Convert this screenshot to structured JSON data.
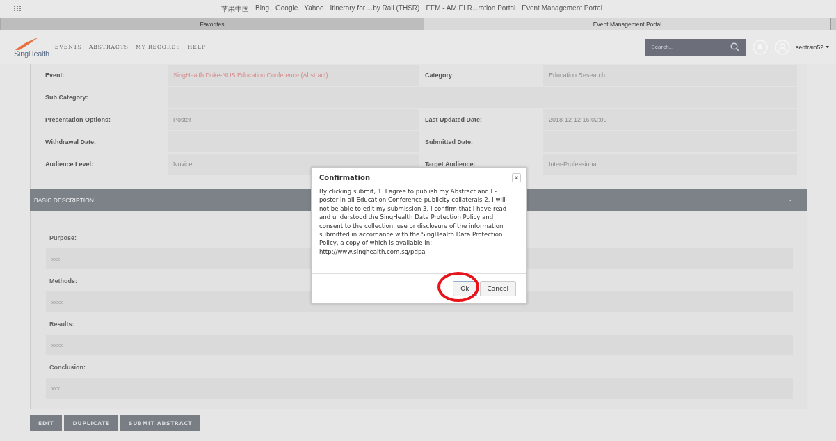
{
  "browser": {
    "bookmarks": [
      "苹果中国",
      "Bing",
      "Google",
      "Yahoo",
      "Itinerary for ...by Rail (THSR)",
      "EFM - AM.EI R...ration Portal",
      "Event Management Portal"
    ],
    "tabs": [
      {
        "label": "Favorites",
        "selected": false
      },
      {
        "label": "Event Management Portal",
        "selected": true
      }
    ],
    "new_tab": "+"
  },
  "header": {
    "logo": "SingHealth",
    "nav": [
      "EVENTS",
      "ABSTRACTS",
      "MY RECORDS",
      "HELP"
    ],
    "search": {
      "placeholder": "Search..."
    },
    "user": "seotrain52"
  },
  "detail_rows": [
    {
      "left": {
        "label": "Event:",
        "value": "SingHealth Duke-NUS Education Conference (Abstract)",
        "kind": "link"
      },
      "right": {
        "label": "Category:",
        "value": "Education Research"
      }
    },
    {
      "left": {
        "label": "Sub Category:"
      }
    },
    {
      "left": {
        "label": "Presentation Options:",
        "value": "Poster"
      },
      "right": {
        "label": "Last Updated Date:",
        "value": "2018-12-12 16:02:00"
      }
    },
    {
      "left": {
        "label": "Withdrawal Date:"
      },
      "right": {
        "label": "Submitted Date:"
      }
    },
    {
      "left": {
        "label": "Audience Level:",
        "value": "Novice"
      },
      "right": {
        "label": "Target Audience:",
        "value": "Inter-Professional"
      }
    }
  ],
  "basic_description": {
    "title": "BASIC DESCRIPTION",
    "toggle": "-",
    "fields": [
      {
        "label": "Purpose:",
        "value": "xxx"
      },
      {
        "label": "Methods:",
        "value": "xxxx"
      },
      {
        "label": "Results:",
        "value": "xxxx"
      },
      {
        "label": "Conclusion:",
        "value": "xxx"
      }
    ]
  },
  "actions": [
    "EDIT",
    "DUPLICATE",
    "SUBMIT ABSTRACT"
  ],
  "dialog": {
    "title": "Confirmation",
    "message": "By clicking submit,  1. I agree to publish my Abstract and E-poster in all Education Conference publicity collaterals 2. I will not be able to edit my submission 3. I confirm that I have read and understood the SingHealth Data Protection Policy and consent to the collection, use or disclosure of the information submitted in accordance with the SingHealth Data Protection Policy, a copy of which is available in: http://www.singhealth.com.sg/pdpa",
    "buttons": [
      {
        "label": "Ok",
        "highlighted": true
      },
      {
        "label": "Cancel",
        "highlighted": false
      }
    ]
  }
}
